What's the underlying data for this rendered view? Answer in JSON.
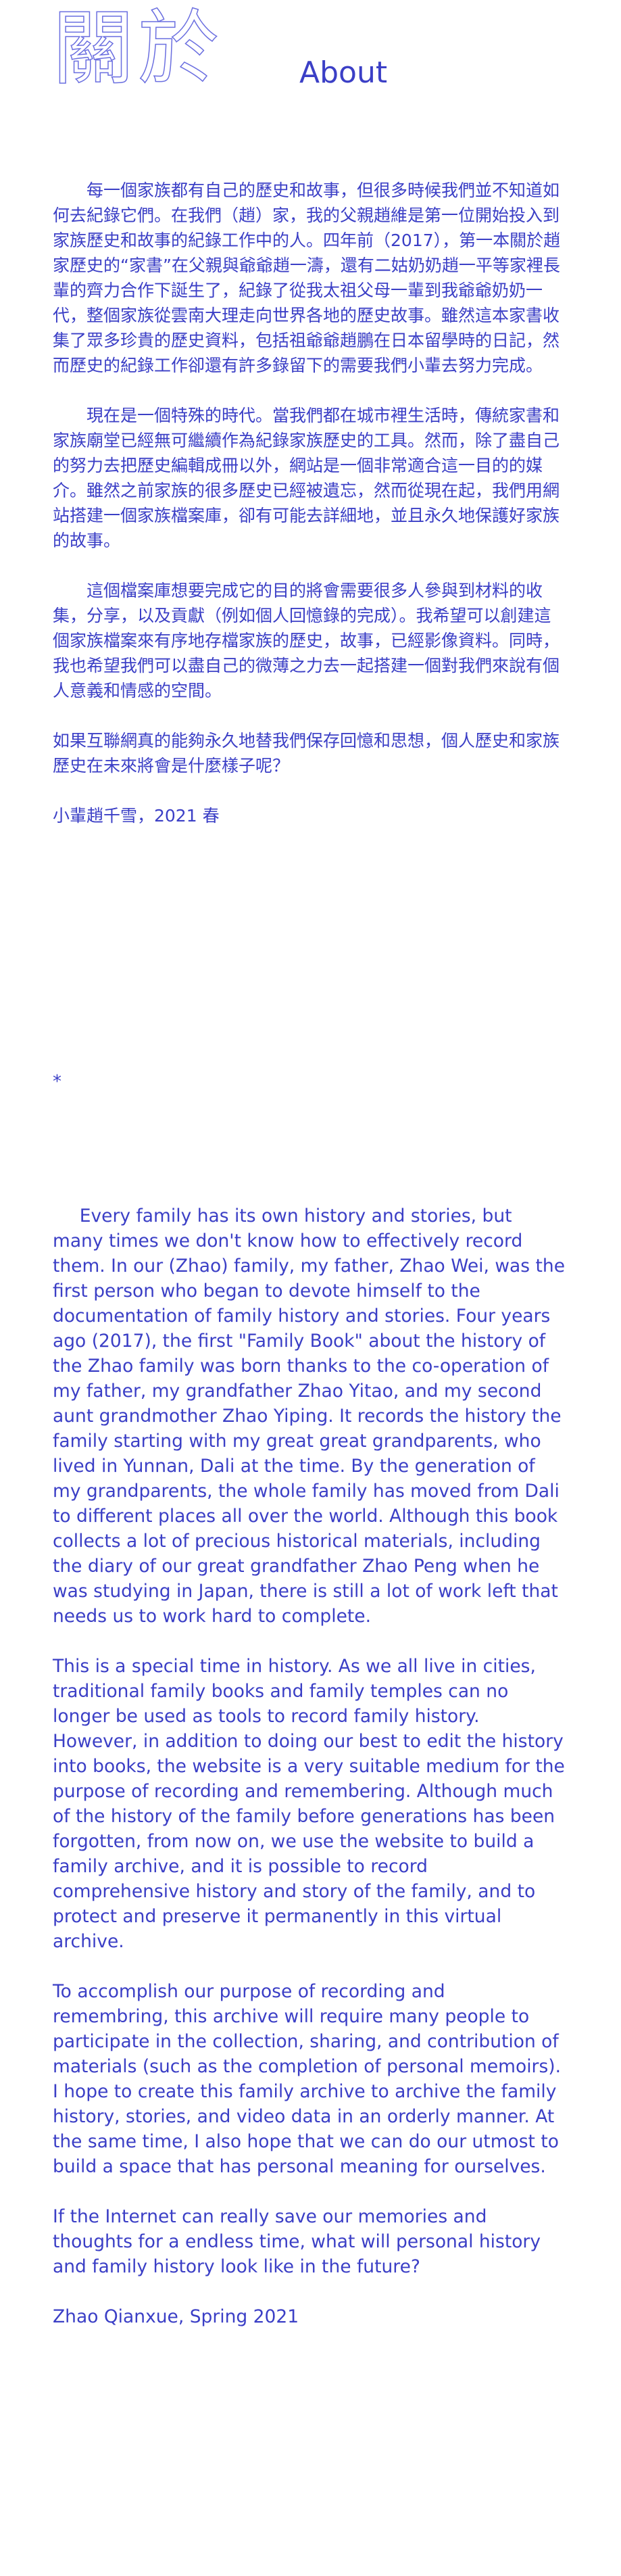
{
  "header": {
    "title_cn": "關於",
    "title_en": "About"
  },
  "chinese": {
    "paragraphs": [
      "每一個家族都有自己的歷史和故事，但很多時候我們並不知道如何去紀錄它們。在我們（趙）家，我的父親趙維是第一位開始投入到家族歷史和故事的紀錄工作中的人。四年前（2017），第一本關於趙家歷史的“家書”在父親與爺爺趙一濤，還有二姑奶奶趙一平等家裡長輩的齊力合作下誕生了，紀錄了從我太祖父母一輩到我爺爺奶奶一代，整個家族從雲南大理走向世界各地的歷史故事。雖然這本家書收集了眾多珍貴的歷史資料，包括祖爺爺趙鵬在日本留學時的日記，然而歷史的紀錄工作卻還有許多錄留下的需要我們小輩去努力完成。",
      "現在是一個特殊的時代。當我們都在城市裡生活時，傳統家書和家族廟堂已經無可繼續作為紀錄家族歷史的工具。然而，除了盡自己的努力去把歷史編輯成冊以外，網站是一個非常適合這一目的的媒介。雖然之前家族的很多歷史已經被遺忘，然而從現在起，我們用網站搭建一個家族檔案庫，卻有可能去詳細地，並且永久地保護好家族的故事。",
      "這個檔案庫想要完成它的目的將會需要很多人參與到材料的收集，分享，以及貢獻（例如個人回憶錄的完成）。我希望可以創建這個家族檔案來有序地存檔家族的歷史，故事，已經影像資料。同時，我也希望我們可以盡自己的微薄之力去一起搭建一個對我們來說有個人意義和情感的空間。",
      "如果互聯網真的能夠永久地替我們保存回憶和思想，個人歷史和家族歷史在未來將會是什麼樣子呢？",
      "小輩趙千雪，2021 春"
    ]
  },
  "separator": "*",
  "english": {
    "paragraphs": [
      "Every family has its own history and stories, but many times we don't know how to effectively record them. In our (Zhao) family, my father, Zhao Wei, was the first person who began to devote himself to the documentation of family history and stories. Four years ago (2017), the first \"Family Book\" about the history of the Zhao family was born thanks to the co-operation of my father, my grandfather Zhao Yitao, and my second aunt grandmother Zhao Yiping. It records the history the family starting with my great great grandparents, who lived in Yunnan, Dali at the time. By the generation of my grandparents, the whole family has moved from Dali to different places all over the world. Although this book collects a lot of precious historical materials, including the diary of our great grandfather Zhao Peng when he was studying in Japan, there is still a lot of work left that needs us to work hard to complete.",
      "This is a special time in history. As we all live in cities, traditional family books and family temples can no longer be used as tools to record family history. However, in addition to doing our best to edit the history into books, the website is a very suitable medium for the purpose of recording and remembering. Although much of the history of the family before generations has been forgotten, from now on, we use the website to build a family archive, and it is possible to record comprehensive history and story of the family, and to protect and preserve it permanently in this virtual archive.",
      "To accomplish our purpose of recording and remembring, this archive will require many people to participate in the collection, sharing, and contribution of materials (such as the completion of personal memoirs). I hope to create this family archive to archive the family history, stories, and video data in an orderly manner. At the same time, I also hope that we can do our utmost to build a space that has personal meaning for ourselves.",
      "If the Internet can really save our memories and thoughts for a endless time, what will personal history and family history look like in the future?",
      "Zhao Qianxue, Spring 2021"
    ]
  }
}
